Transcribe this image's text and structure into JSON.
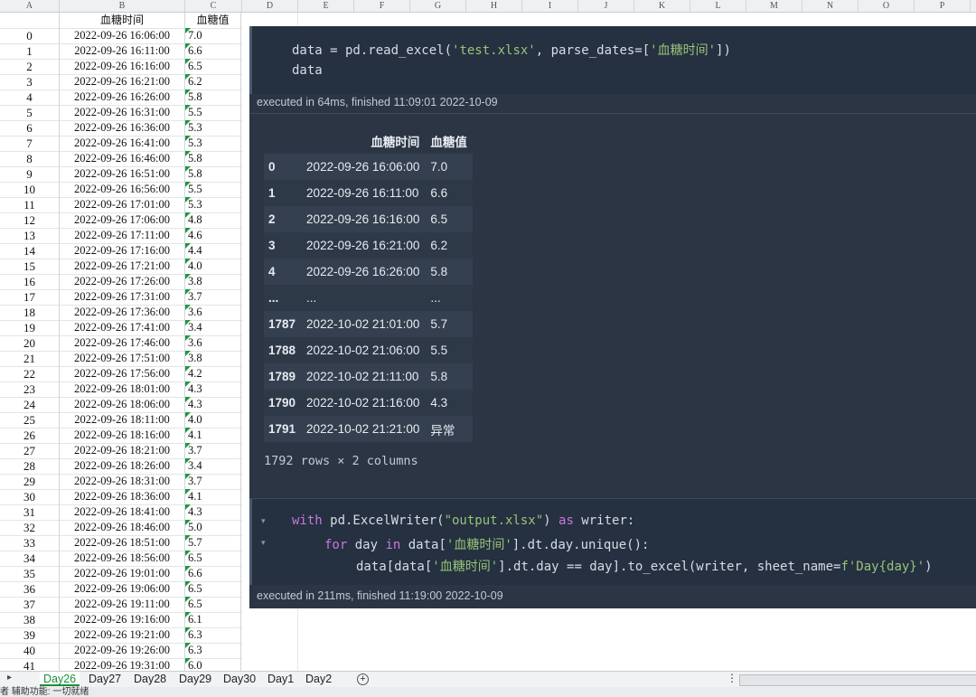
{
  "spreadsheet": {
    "columns": [
      "A",
      "B",
      "C",
      "D",
      "E",
      "F",
      "G",
      "H",
      "I",
      "J",
      "K",
      "L",
      "M",
      "N",
      "O",
      "P"
    ],
    "header": {
      "b": "血糖时间",
      "c": "血糖值"
    },
    "rows": [
      {
        "i": "0",
        "t": "2022-09-26 16:06:00",
        "v": "7.0"
      },
      {
        "i": "1",
        "t": "2022-09-26 16:11:00",
        "v": "6.6"
      },
      {
        "i": "2",
        "t": "2022-09-26 16:16:00",
        "v": "6.5"
      },
      {
        "i": "3",
        "t": "2022-09-26 16:21:00",
        "v": "6.2"
      },
      {
        "i": "4",
        "t": "2022-09-26 16:26:00",
        "v": "5.8"
      },
      {
        "i": "5",
        "t": "2022-09-26 16:31:00",
        "v": "5.5"
      },
      {
        "i": "6",
        "t": "2022-09-26 16:36:00",
        "v": "5.3"
      },
      {
        "i": "7",
        "t": "2022-09-26 16:41:00",
        "v": "5.3"
      },
      {
        "i": "8",
        "t": "2022-09-26 16:46:00",
        "v": "5.8"
      },
      {
        "i": "9",
        "t": "2022-09-26 16:51:00",
        "v": "5.8"
      },
      {
        "i": "10",
        "t": "2022-09-26 16:56:00",
        "v": "5.5"
      },
      {
        "i": "11",
        "t": "2022-09-26 17:01:00",
        "v": "5.3"
      },
      {
        "i": "12",
        "t": "2022-09-26 17:06:00",
        "v": "4.8"
      },
      {
        "i": "13",
        "t": "2022-09-26 17:11:00",
        "v": "4.6"
      },
      {
        "i": "14",
        "t": "2022-09-26 17:16:00",
        "v": "4.4"
      },
      {
        "i": "15",
        "t": "2022-09-26 17:21:00",
        "v": "4.0"
      },
      {
        "i": "16",
        "t": "2022-09-26 17:26:00",
        "v": "3.8"
      },
      {
        "i": "17",
        "t": "2022-09-26 17:31:00",
        "v": "3.7"
      },
      {
        "i": "18",
        "t": "2022-09-26 17:36:00",
        "v": "3.6"
      },
      {
        "i": "19",
        "t": "2022-09-26 17:41:00",
        "v": "3.4"
      },
      {
        "i": "20",
        "t": "2022-09-26 17:46:00",
        "v": "3.6"
      },
      {
        "i": "21",
        "t": "2022-09-26 17:51:00",
        "v": "3.8"
      },
      {
        "i": "22",
        "t": "2022-09-26 17:56:00",
        "v": "4.2"
      },
      {
        "i": "23",
        "t": "2022-09-26 18:01:00",
        "v": "4.3"
      },
      {
        "i": "24",
        "t": "2022-09-26 18:06:00",
        "v": "4.3"
      },
      {
        "i": "25",
        "t": "2022-09-26 18:11:00",
        "v": "4.0"
      },
      {
        "i": "26",
        "t": "2022-09-26 18:16:00",
        "v": "4.1"
      },
      {
        "i": "27",
        "t": "2022-09-26 18:21:00",
        "v": "3.7"
      },
      {
        "i": "28",
        "t": "2022-09-26 18:26:00",
        "v": "3.4"
      },
      {
        "i": "29",
        "t": "2022-09-26 18:31:00",
        "v": "3.7"
      },
      {
        "i": "30",
        "t": "2022-09-26 18:36:00",
        "v": "4.1"
      },
      {
        "i": "31",
        "t": "2022-09-26 18:41:00",
        "v": "4.3"
      },
      {
        "i": "32",
        "t": "2022-09-26 18:46:00",
        "v": "5.0"
      },
      {
        "i": "33",
        "t": "2022-09-26 18:51:00",
        "v": "5.7"
      },
      {
        "i": "34",
        "t": "2022-09-26 18:56:00",
        "v": "6.5"
      },
      {
        "i": "35",
        "t": "2022-09-26 19:01:00",
        "v": "6.6"
      },
      {
        "i": "36",
        "t": "2022-09-26 19:06:00",
        "v": "6.5"
      },
      {
        "i": "37",
        "t": "2022-09-26 19:11:00",
        "v": "6.5"
      },
      {
        "i": "38",
        "t": "2022-09-26 19:16:00",
        "v": "6.1"
      },
      {
        "i": "39",
        "t": "2022-09-26 19:21:00",
        "v": "6.3"
      },
      {
        "i": "40",
        "t": "2022-09-26 19:26:00",
        "v": "6.3"
      },
      {
        "i": "41",
        "t": "2022-09-26 19:31:00",
        "v": "6.0"
      }
    ],
    "tabs": [
      "Day26",
      "Day27",
      "Day28",
      "Day29",
      "Day30",
      "Day1",
      "Day2"
    ],
    "active_tab": "Day26",
    "status_text": "者   辅助功能: 一切就绪"
  },
  "notebook": {
    "cell1": {
      "line1_pre": "data = pd.read_excel(",
      "line1_s1": "'test.xlsx'",
      "line1_mid": ", parse_dates=[",
      "line1_s2": "'血糖时间'",
      "line1_post": "])",
      "line2": "data",
      "exec": "executed in 64ms, finished 11:09:01 2022-10-09"
    },
    "output": {
      "columns": [
        "血糖时间",
        "血糖值"
      ],
      "rows": [
        {
          "i": "0",
          "t": "2022-09-26 16:06:00",
          "v": "7.0"
        },
        {
          "i": "1",
          "t": "2022-09-26 16:11:00",
          "v": "6.6"
        },
        {
          "i": "2",
          "t": "2022-09-26 16:16:00",
          "v": "6.5"
        },
        {
          "i": "3",
          "t": "2022-09-26 16:21:00",
          "v": "6.2"
        },
        {
          "i": "4",
          "t": "2022-09-26 16:26:00",
          "v": "5.8"
        },
        {
          "i": "...",
          "t": "...",
          "v": "..."
        },
        {
          "i": "1787",
          "t": "2022-10-02 21:01:00",
          "v": "5.7"
        },
        {
          "i": "1788",
          "t": "2022-10-02 21:06:00",
          "v": "5.5"
        },
        {
          "i": "1789",
          "t": "2022-10-02 21:11:00",
          "v": "5.8"
        },
        {
          "i": "1790",
          "t": "2022-10-02 21:16:00",
          "v": "4.3"
        },
        {
          "i": "1791",
          "t": "2022-10-02 21:21:00",
          "v": "异常"
        }
      ],
      "shape": "1792 rows × 2 columns"
    },
    "cell2": {
      "l1_kw": "with",
      "l1_a": " pd.ExcelWriter(",
      "l1_s": "\"output.xlsx\"",
      "l1_b": ") ",
      "l1_as": "as",
      "l1_c": " writer:",
      "l2_kw": "for",
      "l2_a": " day ",
      "l2_in": "in",
      "l2_b": " data[",
      "l2_s": "'血糖时间'",
      "l2_c": "].dt.day.unique():",
      "l3_a": "data[data[",
      "l3_s": "'血糖时间'",
      "l3_b": "].dt.day == day].to_excel(writer, sheet_name=",
      "l3_s2": "f'Day{day}'",
      "l3_c": ")",
      "exec": "executed in 211ms, finished 11:19:00 2022-10-09"
    }
  }
}
